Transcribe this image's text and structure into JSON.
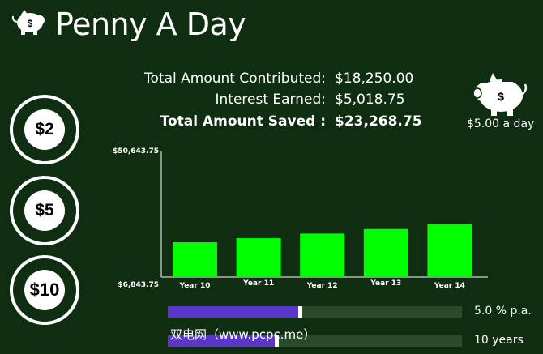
{
  "app": {
    "title": "Penny A Day",
    "icon": "piggy-bank-icon",
    "icon_symbol": "$"
  },
  "amount_buttons": [
    {
      "label": "$2"
    },
    {
      "label": "$5"
    },
    {
      "label": "$10"
    }
  ],
  "summary": {
    "contributed_label": "Total Amount Contributed:",
    "contributed_value": "$18,250.00",
    "interest_label": "Interest Earned:",
    "interest_value": "$5,018.75",
    "saved_label": "Total Amount Saved :",
    "saved_value": "$23,268.75"
  },
  "daily": {
    "icon": "piggy-bank-icon",
    "icon_symbol": "$",
    "rate_text": "$5.00 a day"
  },
  "chart_data": {
    "type": "bar",
    "categories": [
      "Year 10",
      "Year 11",
      "Year 12",
      "Year 13",
      "Year 14"
    ],
    "values": [
      18900,
      20300,
      21900,
      23500,
      25200
    ],
    "ytick_labels": [
      "$50,643.75",
      "$6,843.75"
    ],
    "ylim": [
      6843.75,
      50643.75
    ],
    "bar_color": "#00ff00",
    "grid": false
  },
  "sliders": {
    "rate": {
      "fraction": 0.45,
      "value_text": "5.0 % p.a."
    },
    "years": {
      "fraction": 0.37,
      "value_text": "10 years"
    }
  },
  "watermark": "双电网（www.pcpc.me）",
  "colors": {
    "background": "#0f2d10",
    "accent": "#5a36c9",
    "track": "#2b4a2c",
    "bar": "#00ff00"
  }
}
